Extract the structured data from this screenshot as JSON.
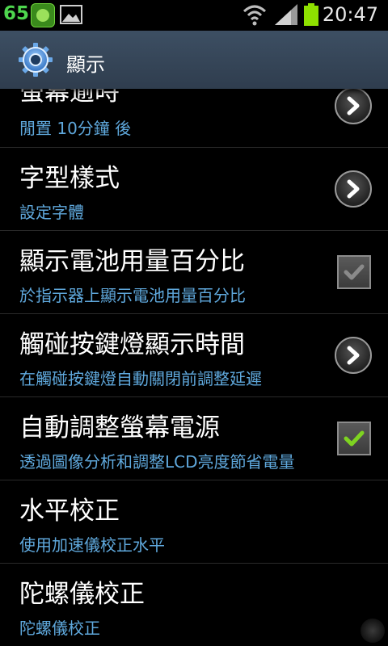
{
  "status_bar": {
    "notification_count": "65",
    "time": "20:47",
    "icons": [
      "app-badge-icon",
      "image-icon",
      "wifi-icon",
      "signal-icon",
      "battery-icon"
    ]
  },
  "header": {
    "title": "顯示",
    "icon": "gear-icon"
  },
  "settings": [
    {
      "title": "螢幕逾時",
      "subtitle": "閒置 10分鐘 後",
      "control": "chevron"
    },
    {
      "title": "字型樣式",
      "subtitle": "設定字體",
      "control": "chevron"
    },
    {
      "title": "顯示電池用量百分比",
      "subtitle": "於指示器上顯示電池用量百分比",
      "control": "checkbox",
      "checked": false
    },
    {
      "title": "觸碰按鍵燈顯示時間",
      "subtitle": "在觸碰按鍵燈自動關閉前調整延遲",
      "control": "chevron"
    },
    {
      "title": "自動調整螢幕電源",
      "subtitle": "透過圖像分析和調整LCD亮度節省電量",
      "control": "checkbox",
      "checked": true
    },
    {
      "title": "水平校正",
      "subtitle": "使用加速儀校正水平",
      "control": "none"
    },
    {
      "title": "陀螺儀校正",
      "subtitle": "陀螺儀校正",
      "control": "none"
    }
  ],
  "colors": {
    "title_bar": "#3d4f63",
    "subtitle_text": "#5fa8dc",
    "check_green": "#7ed321",
    "battery_green": "#8ee000"
  }
}
